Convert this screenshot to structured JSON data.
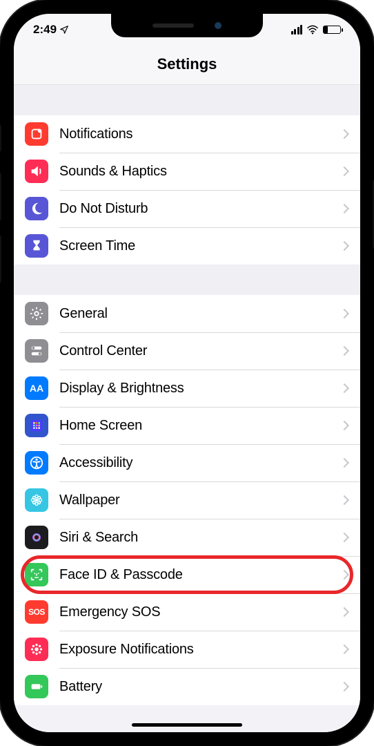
{
  "status": {
    "time": "2:49",
    "location_arrow": "➤"
  },
  "header": {
    "title": "Settings"
  },
  "groups": [
    {
      "items": [
        {
          "id": "notifications",
          "label": "Notifications",
          "icon": "notifications-icon",
          "color": "#ff3b30"
        },
        {
          "id": "sounds",
          "label": "Sounds & Haptics",
          "icon": "sounds-icon",
          "color": "#ff2d55"
        },
        {
          "id": "dnd",
          "label": "Do Not Disturb",
          "icon": "moon-icon",
          "color": "#5856d6"
        },
        {
          "id": "screentime",
          "label": "Screen Time",
          "icon": "hourglass-icon",
          "color": "#5856d6"
        }
      ]
    },
    {
      "items": [
        {
          "id": "general",
          "label": "General",
          "icon": "gear-icon",
          "color": "#8e8e93"
        },
        {
          "id": "controlcenter",
          "label": "Control Center",
          "icon": "switches-icon",
          "color": "#8e8e93"
        },
        {
          "id": "display",
          "label": "Display & Brightness",
          "icon": "text-size-icon",
          "color": "#007aff"
        },
        {
          "id": "homescreen",
          "label": "Home Screen",
          "icon": "grid-icon",
          "color": "#3355cc"
        },
        {
          "id": "accessibility",
          "label": "Accessibility",
          "icon": "accessibility-icon",
          "color": "#007aff"
        },
        {
          "id": "wallpaper",
          "label": "Wallpaper",
          "icon": "flower-icon",
          "color": "#36c6e3"
        },
        {
          "id": "siri",
          "label": "Siri & Search",
          "icon": "siri-icon",
          "color": "#1c1c1e"
        },
        {
          "id": "faceid",
          "label": "Face ID & Passcode",
          "icon": "face-id-icon",
          "color": "#34c759",
          "highlighted": true
        },
        {
          "id": "sos",
          "label": "Emergency SOS",
          "icon": "sos-icon",
          "color": "#ff3b30"
        },
        {
          "id": "exposure",
          "label": "Exposure Notifications",
          "icon": "exposure-icon",
          "color": "#ff2d55"
        },
        {
          "id": "battery",
          "label": "Battery",
          "icon": "battery-icon",
          "color": "#34c759"
        }
      ]
    }
  ],
  "annotation": {
    "highlight_target": "faceid",
    "highlight_color": "#e8272a"
  }
}
